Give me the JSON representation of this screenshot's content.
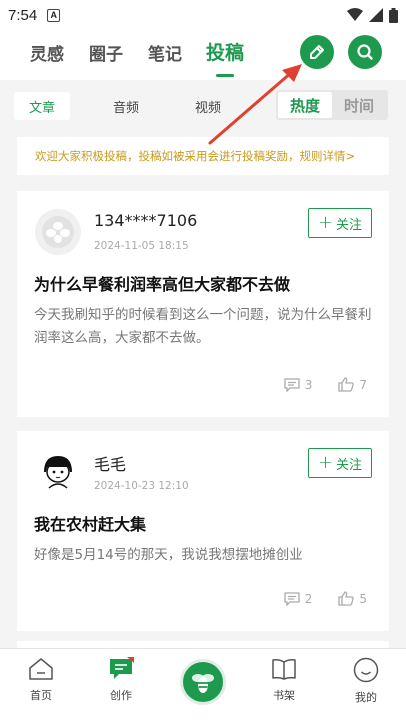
{
  "status_bar": {
    "time": "7:54",
    "badge": "A"
  },
  "top_tabs": [
    {
      "label": "灵感"
    },
    {
      "label": "圈子"
    },
    {
      "label": "笔记"
    },
    {
      "label": "投稿"
    }
  ],
  "sub_tabs": [
    {
      "label": "文章"
    },
    {
      "label": "音频"
    },
    {
      "label": "视频"
    }
  ],
  "sort": [
    {
      "label": "热度"
    },
    {
      "label": "时间"
    }
  ],
  "notice": "欢迎大家积极投稿，投稿如被采用会进行投稿奖励，规则详情>",
  "posts": [
    {
      "username": "134****7106",
      "date": "2024-11-05 18:15",
      "follow_label": "关注",
      "title": "为什么早餐利润率高但大家都不去做",
      "excerpt": "今天我刷知乎的时候看到这么一个问题，说为什么早餐利润率这么高，大家都不去做。",
      "comments": "3",
      "likes": "7"
    },
    {
      "username": "毛毛",
      "date": "2024-10-23 12:10",
      "follow_label": "关注",
      "title": "我在农村赶大集",
      "excerpt": "好像是5月14号的那天，我说我想摆地摊创业",
      "comments": "2",
      "likes": "5"
    }
  ],
  "bottom_nav": [
    {
      "label": "首页",
      "icon": "home-icon"
    },
    {
      "label": "创作",
      "icon": "create-icon"
    },
    {
      "label": "",
      "icon": "bee-logo-icon"
    },
    {
      "label": "书架",
      "icon": "book-icon"
    },
    {
      "label": "我的",
      "icon": "profile-icon"
    }
  ],
  "colors": {
    "accent": "#1e9a4f",
    "notice_text": "#c99a1a",
    "annotation_arrow": "#e0412f"
  }
}
